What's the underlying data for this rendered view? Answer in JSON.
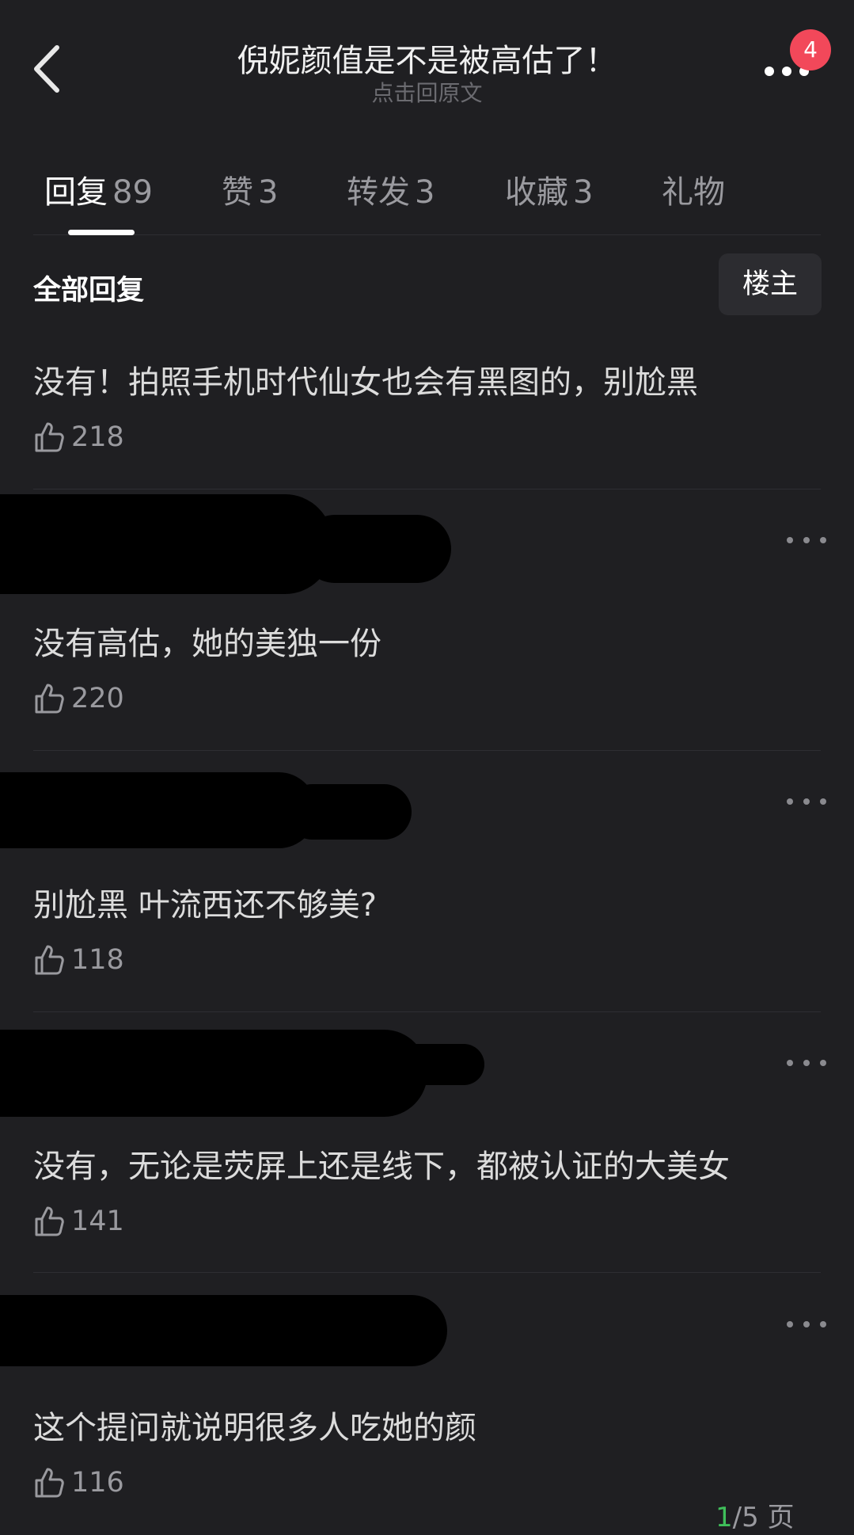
{
  "header": {
    "title": "倪妮颜值是不是被高估了！",
    "subtitle": "点击回原文",
    "badge_count": "4"
  },
  "tabs": [
    {
      "label": "回复",
      "count": "89",
      "active": true
    },
    {
      "label": "赞",
      "count": "3",
      "active": false
    },
    {
      "label": "转发",
      "count": "3",
      "active": false
    },
    {
      "label": "收藏",
      "count": "3",
      "active": false
    },
    {
      "label": "礼物",
      "count": "",
      "active": false
    }
  ],
  "section": {
    "title": "全部回复",
    "op_button": "楼主"
  },
  "replies": [
    {
      "text": "没有！拍照手机时代仙女也会有黑图的，别尬黑",
      "likes": "218"
    },
    {
      "text": "没有高估，她的美独一份",
      "likes": "220"
    },
    {
      "text": "别尬黑  叶流西还不够美?",
      "likes": "118"
    },
    {
      "text": "没有，无论是荧屏上还是线下，都被认证的大美女",
      "likes": "141"
    },
    {
      "text": "这个提问就说明很多人吃她的颜",
      "likes": "116"
    }
  ],
  "pager": {
    "current": "1",
    "total_text": "/5 页"
  },
  "colors": {
    "background": "#1f1f22",
    "badge": "#f2485a",
    "pager_current": "#3fbf5a"
  },
  "icons": [
    "back-chevron-icon",
    "more-dots-icon",
    "thumbs-up-icon"
  ]
}
